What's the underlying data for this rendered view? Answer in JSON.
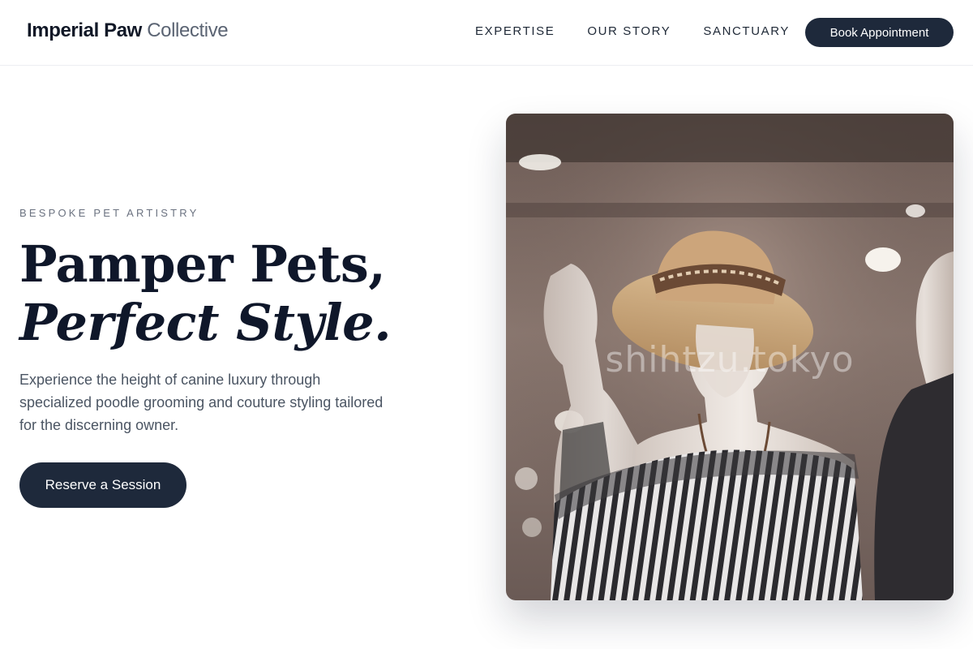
{
  "brand": {
    "strong": "Imperial Paw",
    "light": " Collective"
  },
  "nav": {
    "items": [
      {
        "label": "EXPERTISE"
      },
      {
        "label": "OUR STORY"
      },
      {
        "label": "SANCTUARY"
      }
    ]
  },
  "header": {
    "cta_label": "Book Appointment"
  },
  "hero": {
    "eyebrow": "BESPOKE PET ARTISTRY",
    "headline_line1": "Pamper Pets,",
    "headline_line2": "Perfect Style.",
    "lede": "Experience the height of canine luxury through specialized poodle grooming and couture styling tailored for the discerning owner.",
    "cta_label": "Reserve a Session",
    "image_watermark": "shihtzu.tokyo"
  },
  "colors": {
    "primary": "#1e293b",
    "headline": "#0f172a",
    "body_text": "#4b5563",
    "muted": "#6b7280"
  },
  "icons": []
}
